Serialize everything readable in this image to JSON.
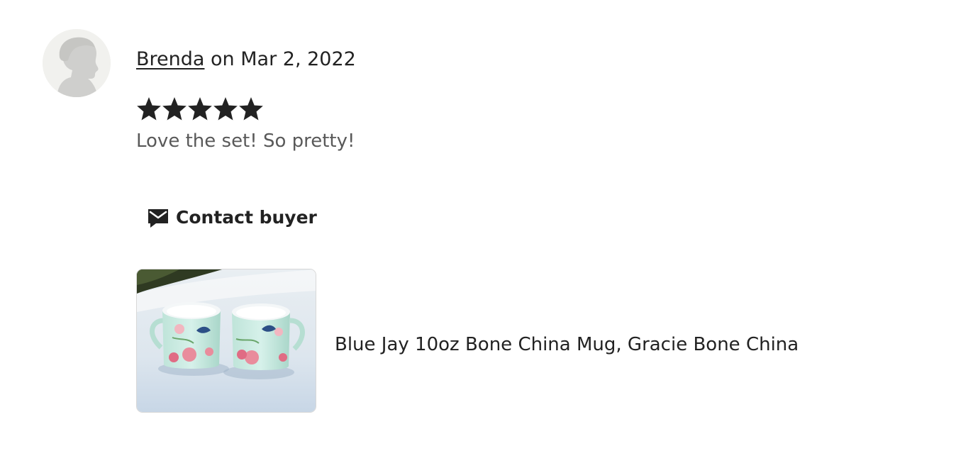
{
  "review": {
    "reviewer_name": "Brenda",
    "date_text": " on Mar 2, 2022",
    "rating": 5,
    "rating_max": 5,
    "text": "Love the set! So pretty!"
  },
  "actions": {
    "contact_label": "Contact buyer",
    "contact_icon": "mail-icon"
  },
  "product": {
    "title": "Blue Jay 10oz Bone China Mug, Gracie Bone China"
  },
  "colors": {
    "text": "#222222",
    "muted_text": "#595959",
    "star": "#222222",
    "avatar_bg": "#f1f1ee",
    "avatar_figure": "#cfcfcd"
  }
}
